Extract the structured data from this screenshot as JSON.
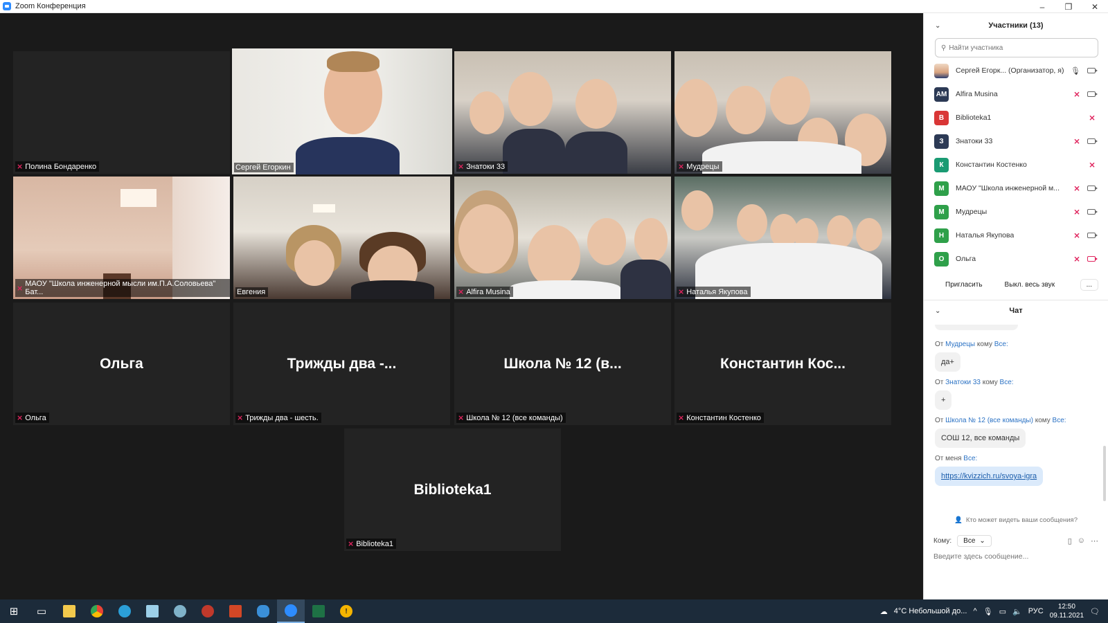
{
  "window": {
    "title": "Zoom Конференция",
    "controls": [
      "–",
      "❐",
      "✕"
    ]
  },
  "tiles": [
    {
      "name": "Полина Бондаренко",
      "big": "",
      "muted": true
    },
    {
      "name": "Сергей Егоркин",
      "big": "",
      "muted": false,
      "active": true
    },
    {
      "name": "Знатоки 33",
      "big": "",
      "muted": true
    },
    {
      "name": "Мудрецы",
      "big": "",
      "muted": true
    },
    {
      "name": "МАОУ \"Школа инженерной мысли им.П.А.Соловьева\" Бат...",
      "big": "",
      "muted": true
    },
    {
      "name": "Евгения",
      "big": "",
      "muted": false
    },
    {
      "name": "Alfira Musina",
      "big": "",
      "muted": true
    },
    {
      "name": "Наталья Якупова",
      "big": "",
      "muted": true
    },
    {
      "name": "Ольга",
      "big": "Ольга",
      "muted": true
    },
    {
      "name": "Трижды два - шесть.",
      "big": "Трижды два -...",
      "muted": true
    },
    {
      "name": "Школа № 12 (все команды)",
      "big": "Школа № 12 (в...",
      "muted": true
    },
    {
      "name": "Константин Костенко",
      "big": "Константин Кос...",
      "muted": true
    },
    {
      "name": "Biblioteka1",
      "big": "Biblioteka1",
      "muted": true
    }
  ],
  "participants": {
    "title": "Участники (13)",
    "search_placeholder": "Найти участника",
    "list": [
      {
        "initials": "",
        "name": "Сергей Егорк...  (Организатор, я)",
        "color": "",
        "mic": "on",
        "cam": "on"
      },
      {
        "initials": "AM",
        "name": "Alfira Musina",
        "color": "#2c3a55",
        "mic": "off",
        "cam": "on"
      },
      {
        "initials": "B",
        "name": "Biblioteka1",
        "color": "#d93636",
        "mic": "off",
        "cam": ""
      },
      {
        "initials": "З",
        "name": "Знатоки 33",
        "color": "#2c3a55",
        "mic": "off",
        "cam": "on"
      },
      {
        "initials": "К",
        "name": "Константин Костенко",
        "color": "#1a9b73",
        "mic": "off",
        "cam": ""
      },
      {
        "initials": "М",
        "name": "МАОУ \"Школа инженерной м...",
        "color": "#2fa04a",
        "mic": "off",
        "cam": "on"
      },
      {
        "initials": "М",
        "name": "Мудрецы",
        "color": "#2fa04a",
        "mic": "off",
        "cam": "on"
      },
      {
        "initials": "Н",
        "name": "Наталья Якупова",
        "color": "#2fa04a",
        "mic": "off",
        "cam": "on"
      },
      {
        "initials": "О",
        "name": "Ольга",
        "color": "#2fa04a",
        "mic": "off",
        "cam": "off"
      }
    ],
    "invite": "Пригласить",
    "mute_all": "Выкл. весь звук",
    "more": "..."
  },
  "chat": {
    "title": "Чат",
    "messages": [
      {
        "prefix": "От ",
        "from": "Мудрецы",
        "mid": " кому ",
        "to": "Все:",
        "text": "да+",
        "link": false
      },
      {
        "prefix": "От ",
        "from": "Знатоки 33",
        "mid": " кому ",
        "to": "Все:",
        "text": "+",
        "link": false
      },
      {
        "prefix": "От ",
        "from": "Школа № 12 (все команды)",
        "mid": " кому ",
        "to": "Все:",
        "text": "СОШ 12, все команды",
        "link": false
      },
      {
        "prefix": "От меня ",
        "from": "",
        "mid": "",
        "to": "Все:",
        "text": "https://kvizzich.ru/svoya-igra",
        "link": true
      }
    ],
    "who_sees": "Кто может видеть ваши сообщения?",
    "to_label": "Кому:",
    "to_value": "Все",
    "input_placeholder": "Введите здесь сообщение..."
  },
  "taskbar": {
    "weather": "4°C  Небольшой до...",
    "lang": "РУС",
    "time": "12:50",
    "date": "09.11.2021"
  },
  "colors": {
    "active_speaker": "#c6e65a",
    "muted": "#e0245e",
    "link": "#2b72c4",
    "taskbar": "#1c2b3a"
  }
}
